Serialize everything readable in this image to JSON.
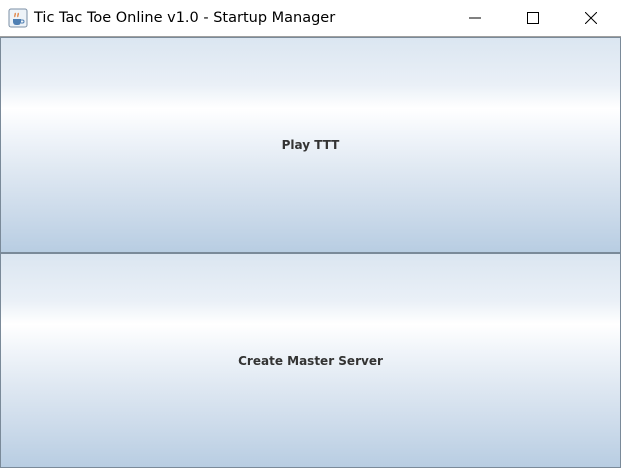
{
  "window": {
    "title": "Tic Tac Toe Online v1.0 - Startup Manager",
    "icon": "java-coffee-cup-icon",
    "controls": [
      "minimize-icon",
      "maximize-icon",
      "close-icon"
    ]
  },
  "buttons": {
    "play_label": "Play TTT",
    "server_label": "Create Master Server"
  },
  "colors": {
    "button_text": "#333333",
    "button_border": "#7a8a99",
    "button_gradient_top": "#dbe6f1",
    "button_gradient_highlight": "#ffffff",
    "button_gradient_bottom": "#b8cde2"
  }
}
